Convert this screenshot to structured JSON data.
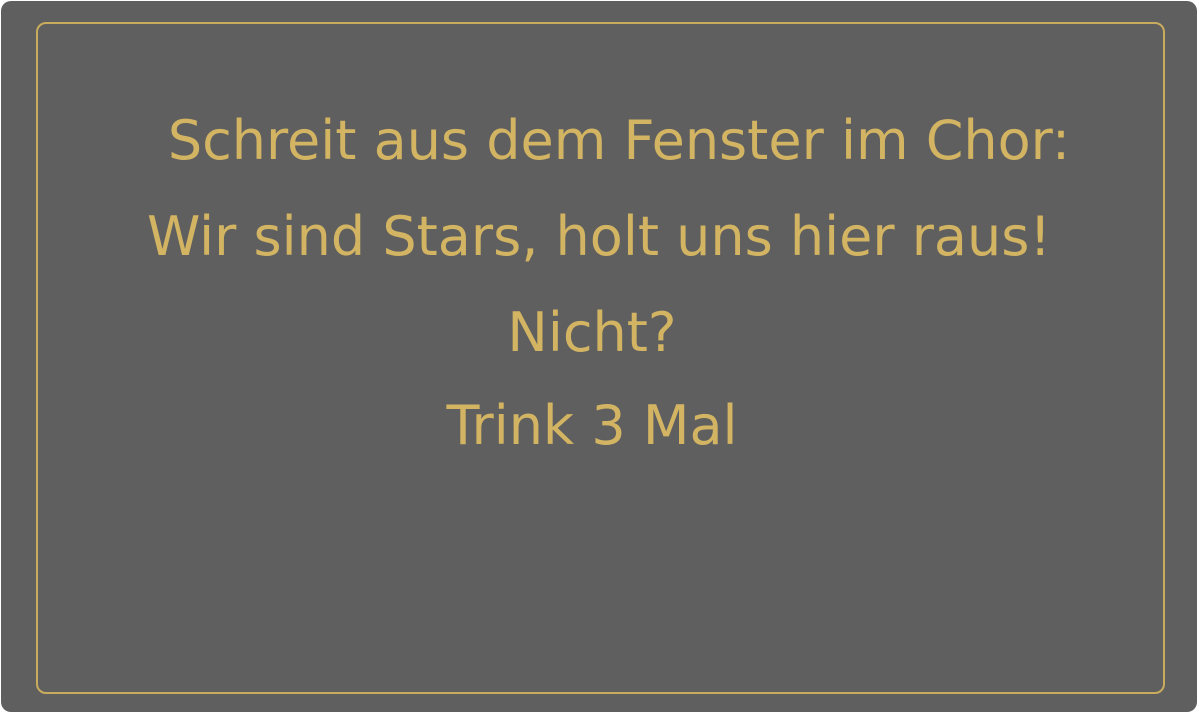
{
  "card": {
    "lines": [
      "Schreit aus dem Fenster im Chor:",
      "Wir sind Stars, holt uns hier raus!",
      "Nicht?",
      "Trink 3 Mal"
    ]
  },
  "colors": {
    "background": "#5f5f5f",
    "text": "#d2b463",
    "border": "#c8ab5d"
  }
}
